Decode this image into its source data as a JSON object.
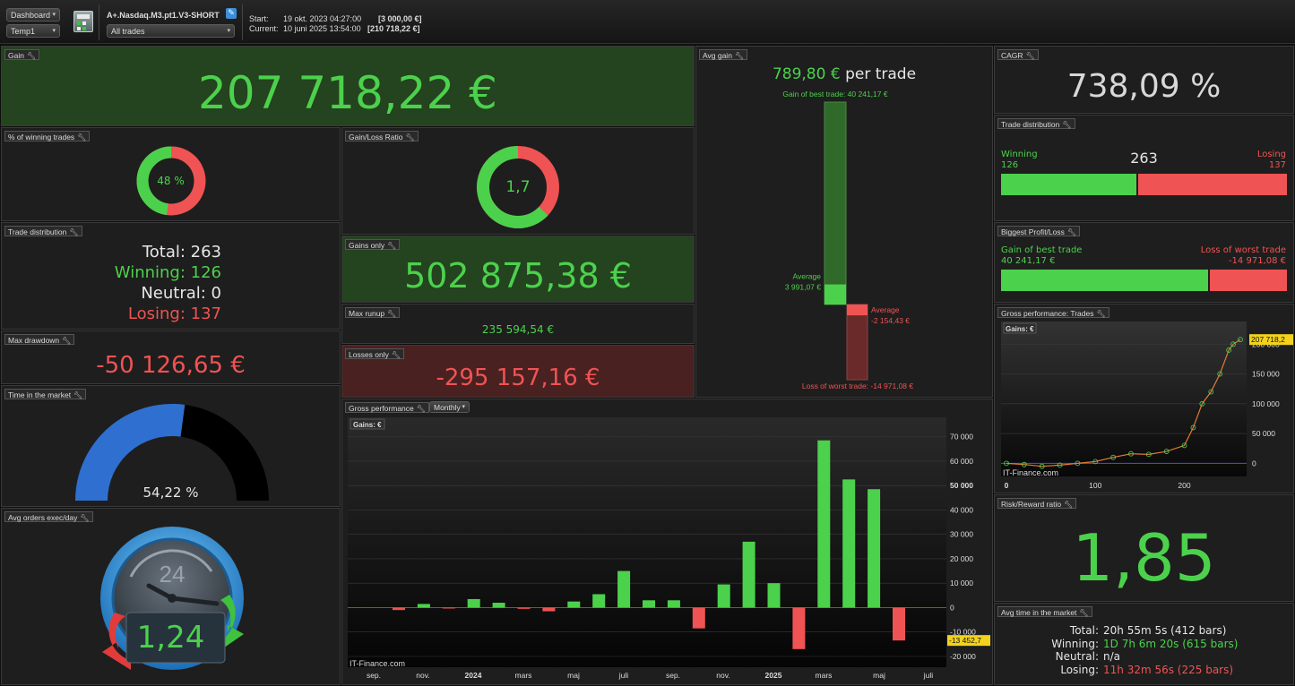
{
  "topbar": {
    "dashboard_select": "Dashboard",
    "temp_select": "Temp1",
    "strategy_name": "A+.Nasdaq.M3.pt1.V3-SHORT",
    "trades_select": "All trades",
    "start_label": "Start:",
    "start_date": "19 okt. 2023 04:27:00",
    "start_value": "[3 000,00 €]",
    "current_label": "Current:",
    "current_date": "10 juni 2025 13:54:00",
    "current_value": "[210 718,22 €]"
  },
  "gain": {
    "title": "Gain",
    "value": "207 718,22 €"
  },
  "winning_pct": {
    "title": "% of winning trades",
    "value": "48 %",
    "fraction": 0.48
  },
  "gain_loss_ratio": {
    "title": "Gain/Loss Ratio",
    "value": "1,7",
    "fraction": 0.63
  },
  "trade_dist_left": {
    "title": "Trade distribution",
    "total": "Total: 263",
    "winning": "Winning: 126",
    "neutral": "Neutral: 0",
    "losing": "Losing: 137"
  },
  "gains_only": {
    "title": "Gains only",
    "value": "502 875,38 €"
  },
  "max_runup": {
    "title": "Max runup",
    "value": "235 594,54 €"
  },
  "losses_only": {
    "title": "Losses only",
    "value": "-295 157,16 €"
  },
  "max_drawdown": {
    "title": "Max drawdown",
    "value": "-50 126,65 €"
  },
  "time_in_market": {
    "title": "Time in the market",
    "value": "54,22 %",
    "fraction": 0.5422
  },
  "avg_orders": {
    "title": "Avg orders exec/day",
    "dial": "24",
    "value": "1,24"
  },
  "avg_gain": {
    "title": "Avg gain",
    "value": "789,80 €",
    "suffix": "per trade",
    "best_label": "Gain of best trade: 40 241,17 €",
    "avg_win_label": "Average",
    "avg_win_value": "3 991,07 €",
    "avg_loss_label": "Average",
    "avg_loss_value": "-2 154,43 €",
    "worst_label": "Loss of worst trade: -14 971,08 €",
    "best": 40241.17,
    "avg_win": 3991.07,
    "avg_loss": -2154.43,
    "worst": -14971.08
  },
  "cagr": {
    "title": "CAGR",
    "value": "738,09 %"
  },
  "trade_dist_right": {
    "title": "Trade distribution",
    "winning_label": "Winning",
    "winning_value": "126",
    "total": "263",
    "losing_label": "Losing",
    "losing_value": "137",
    "win_fraction": 0.479
  },
  "biggest": {
    "title": "Biggest Profit/Loss",
    "gain_label": "Gain of best trade",
    "gain_value": "40 241,17 €",
    "loss_label": "Loss of worst trade",
    "loss_value": "-14 971,08 €",
    "gain_fraction": 0.729
  },
  "gross_trades": {
    "title": "Gross performance: Trades",
    "legend": "Gains: €",
    "watermark": "IT-Finance.com",
    "last_value": "207 718,2"
  },
  "risk_reward": {
    "title": "Risk/Reward ratio",
    "value": "1,85"
  },
  "avg_time": {
    "title": "Avg time in the market",
    "total_label": "Total:",
    "total_value": "20h 55m 5s (412 bars)",
    "winning_label": "Winning:",
    "winning_value": "1D 7h 6m 20s (615 bars)",
    "neutral_label": "Neutral:",
    "neutral_value": "n/a",
    "losing_label": "Losing:",
    "losing_value": "11h 32m 56s (225 bars)"
  },
  "gross_monthly": {
    "title": "Gross performance",
    "period_select": "Monthly",
    "legend": "Gains: €",
    "watermark": "IT-Finance.com",
    "last_value": "-13 452,7"
  },
  "colors": {
    "green": "#4cd14c",
    "red": "#f05353",
    "blue": "#2f6fd0",
    "panel": "#1e1e1e"
  },
  "chart_data": [
    {
      "type": "bar",
      "title": "Gross performance",
      "categories": [
        "2023-10",
        "2023-11",
        "2023-12",
        "2024-01",
        "2024-02",
        "2024-03",
        "2024-04",
        "2024-05",
        "2024-06",
        "2024-07",
        "2024-08",
        "2024-09",
        "2024-10",
        "2024-11",
        "2024-12",
        "2025-01",
        "2025-02",
        "2025-03",
        "2025-04",
        "2025-05",
        "2025-06"
      ],
      "values": [
        -1000,
        1500,
        -300,
        3500,
        2000,
        -500,
        -1500,
        2500,
        5500,
        15000,
        3000,
        3000,
        -8500,
        9500,
        27000,
        10000,
        -17000,
        68500,
        52500,
        48500,
        -13452.7
      ],
      "ylim": [
        -20000,
        75000
      ],
      "yticks": [
        -20000,
        -10000,
        0,
        10000,
        20000,
        30000,
        40000,
        50000,
        60000,
        70000
      ],
      "ytick_labels": [
        "-20 000",
        "-10 000",
        "0",
        "10 000",
        "20 000",
        "30 000",
        "40 000",
        "50 000",
        "60 000",
        "70 000"
      ],
      "xtick_labels": [
        "sep.",
        "nov.",
        "2024",
        "mars",
        "maj",
        "juli",
        "sep.",
        "nov.",
        "2025",
        "mars",
        "maj",
        "juli"
      ],
      "legend": "Gains: €"
    },
    {
      "type": "line",
      "title": "Gross performance: Trades",
      "x": [
        0,
        20,
        40,
        60,
        80,
        100,
        120,
        140,
        160,
        180,
        200,
        210,
        220,
        230,
        240,
        250,
        255,
        263
      ],
      "y": [
        0,
        -2000,
        -5000,
        -3000,
        0,
        3000,
        10000,
        16000,
        15000,
        20000,
        30000,
        60000,
        100000,
        120000,
        150000,
        190000,
        200000,
        207718
      ],
      "ylim": [
        -10000,
        220000
      ],
      "yticks": [
        0,
        50000,
        100000,
        150000,
        200000
      ],
      "ytick_labels": [
        "0",
        "50 000",
        "100 000",
        "150 000",
        "200 000"
      ],
      "xticks": [
        0,
        100,
        200
      ],
      "xtick_labels": [
        "0",
        "100",
        "200"
      ],
      "legend": "Gains: €"
    }
  ]
}
